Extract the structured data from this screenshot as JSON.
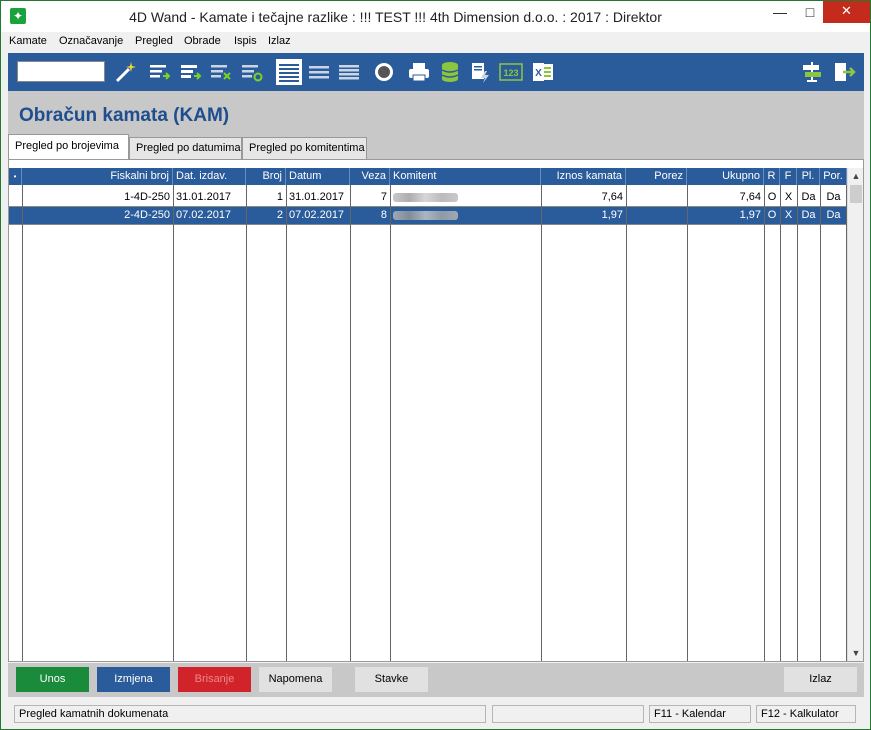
{
  "window": {
    "title": "4D Wand - Kamate i tečajne razlike : !!! TEST !!! 4th Dimension d.o.o. : 2017 : Direktor",
    "min_glyph": "—",
    "max_glyph": "□",
    "close_glyph": "✕"
  },
  "menu": [
    "Kamate",
    "Označavanje",
    "Pregled",
    "Obrade",
    "Ispis",
    "Izlaz"
  ],
  "toolbar": {
    "search_value": "",
    "icons": [
      "wand-icon",
      "list-add-icon",
      "list-add-bold-icon",
      "list-delete-icon",
      "list-refresh-icon",
      "list-view-active-icon",
      "list-view-icon",
      "list-view-alt-icon",
      "record-icon",
      "printer-icon",
      "database-icon",
      "document-flash-icon",
      "numeric-123-icon",
      "excel-icon",
      "signpost-icon",
      "exit-icon"
    ],
    "numeric_label": "123",
    "excel_label": "X"
  },
  "page": {
    "title": "Obračun kamata (KAM)"
  },
  "tabs": [
    {
      "label": "Pregled po brojevima",
      "active": true
    },
    {
      "label": "Pregled po datumima",
      "active": false
    },
    {
      "label": "Pregled po komitentima",
      "active": false
    }
  ],
  "grid": {
    "marker": "•",
    "columns": [
      "Fiskalni broj",
      "Dat. izdav.",
      "Broj",
      "Datum",
      "Veza",
      "Komitent",
      "Iznos kamata",
      "Porez",
      "Ukupno",
      "R",
      "F",
      "Pl.",
      "Por."
    ],
    "rows": [
      {
        "fiskalni_broj": "1-4D-250",
        "dat_izdav": "31.01.2017",
        "broj": "1",
        "datum": "31.01.2017",
        "veza": "7",
        "iznos_kamata": "7,64",
        "porez": "",
        "ukupno": "7,64",
        "r": "O",
        "f": "X",
        "pl": "Da",
        "por": "Da"
      },
      {
        "fiskalni_broj": "2-4D-250",
        "dat_izdav": "07.02.2017",
        "broj": "2",
        "datum": "07.02.2017",
        "veza": "8",
        "iznos_kamata": "1,97",
        "porez": "",
        "ukupno": "1,97",
        "r": "O",
        "f": "X",
        "pl": "Da",
        "por": "Da"
      }
    ],
    "selected_row": 1
  },
  "scrollbar": {
    "up": "▲",
    "down": "▼"
  },
  "buttons": {
    "unos": "Unos",
    "izmjena": "Izmjena",
    "brisanje": "Brisanje",
    "napomena": "Napomena",
    "stavke": "Stavke",
    "izlaz": "Izlaz"
  },
  "status": {
    "message": "Pregled kamatnih dokumenata",
    "f11": "F11 - Kalendar",
    "f12": "F12 - Kalkulator"
  },
  "colors": {
    "accent_blue": "#2a5b9b",
    "title_blue": "#1e4e8e",
    "green": "#1a8a3b",
    "red": "#d1232a"
  }
}
